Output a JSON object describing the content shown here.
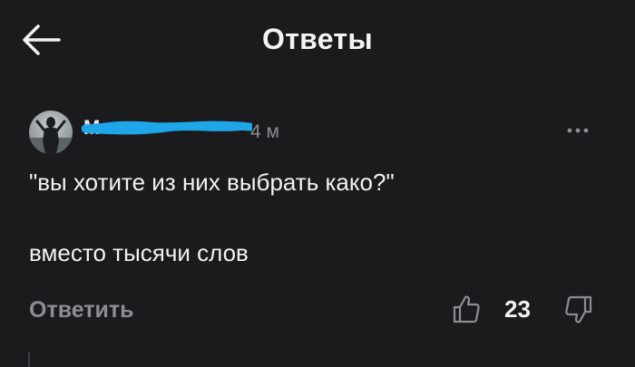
{
  "header": {
    "title": "Ответы",
    "back_icon": "arrow-left-icon"
  },
  "comment": {
    "author": "M",
    "timestamp": "4 м",
    "lines": [
      "\"вы хотите из них выбрать како?\"",
      "вместо тысячи слов"
    ],
    "more_icon": "more-horizontal-icon",
    "redaction_color": "#1fa6e8"
  },
  "actions": {
    "reply_label": "Ответить",
    "like_count": "23",
    "like_icon": "thumbs-up-icon",
    "dislike_icon": "thumbs-down-icon"
  },
  "colors": {
    "background": "#1b1b1e",
    "text_primary": "#f2f2f2",
    "text_secondary": "#8d8d92"
  }
}
